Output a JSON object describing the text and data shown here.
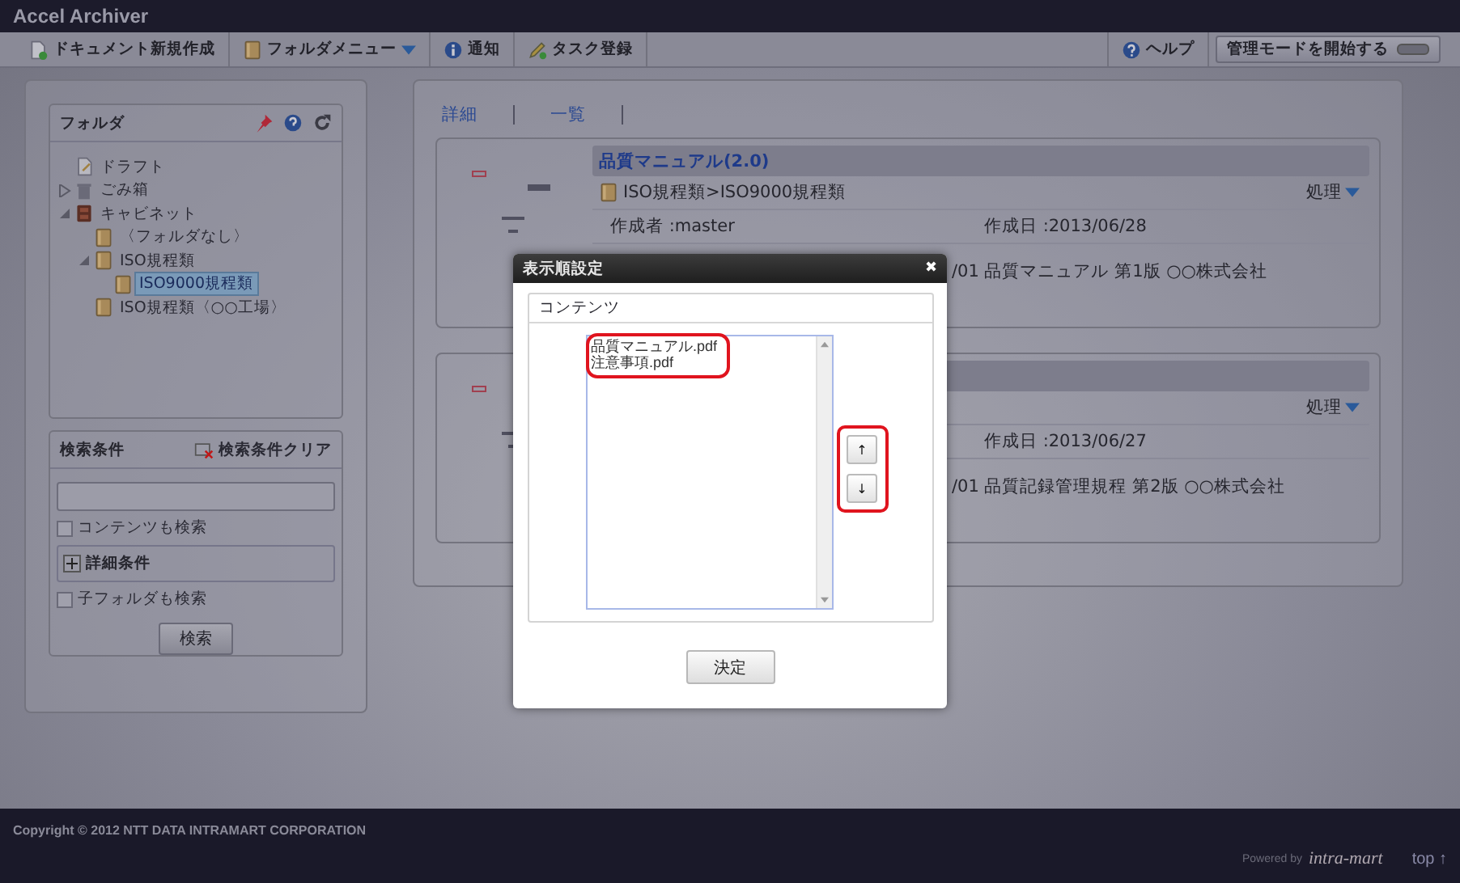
{
  "app": {
    "title": "Accel Archiver"
  },
  "toolbar": {
    "left": [
      {
        "label": "ドキュメント新規作成",
        "kind": "document"
      },
      {
        "label": "フォルダメニュー",
        "kind": "folder-menu"
      },
      {
        "label": "通知",
        "kind": "info"
      },
      {
        "label": "タスク登録",
        "kind": "pencil"
      }
    ],
    "help": "ヘルプ",
    "admin_button": "管理モードを開始する"
  },
  "folder_panel": {
    "title": "フォルダ",
    "tree": [
      {
        "label": "ドラフト",
        "kind": "draft",
        "selected": false
      },
      {
        "label": "ごみ箱",
        "kind": "trash",
        "expanded": false,
        "selected": false
      },
      {
        "label": "キャビネット",
        "kind": "cabinet",
        "expanded": true,
        "selected": false,
        "children": [
          {
            "label": "〈フォルダなし〉",
            "kind": "folder",
            "selected": false
          },
          {
            "label": "ISO規程類",
            "kind": "folder",
            "expanded": true,
            "selected": false,
            "children": [
              {
                "label": "ISO9000規程類",
                "kind": "folder",
                "selected": true
              }
            ]
          },
          {
            "label": "ISO規程類〈○○工場〉",
            "kind": "folder",
            "selected": false
          }
        ]
      }
    ]
  },
  "search_panel": {
    "title": "検索条件",
    "clear": "検索条件クリア",
    "content_search": {
      "label": "コンテンツも検索",
      "checked": false
    },
    "details": {
      "label": "詳細条件",
      "expanded": false
    },
    "subfolder_search": {
      "label": "子フォルダも検索",
      "checked": false
    },
    "button": "検索"
  },
  "view_links": [
    "詳細",
    "一覧"
  ],
  "documents": [
    {
      "title": "品質マニュアル(2.0)",
      "path": "ISO規程類>ISO9000規程類",
      "action": "処理",
      "author": "作成者 :master",
      "date": "作成日 :2013/06/28",
      "description": "/01 品質マニュアル 第1版 ○○株式会社"
    },
    {
      "action": "処理",
      "date": "作成日 :2013/06/27",
      "description": "/01 品質記録管理規程 第2版 ○○株式会社"
    }
  ],
  "dialog": {
    "title": "表示順設定",
    "close": "✖",
    "section": "コンテンツ",
    "items": [
      "品質マニュアル.pdf",
      "注意事項.pdf"
    ],
    "up": "↑",
    "down": "↓",
    "ok": "決定"
  },
  "footer": {
    "copyright": "Copyright © 2012 NTT DATA INTRAMART CORPORATION",
    "powered_by": "Powered by",
    "logo": "intra-mart",
    "top": "top ↑"
  }
}
